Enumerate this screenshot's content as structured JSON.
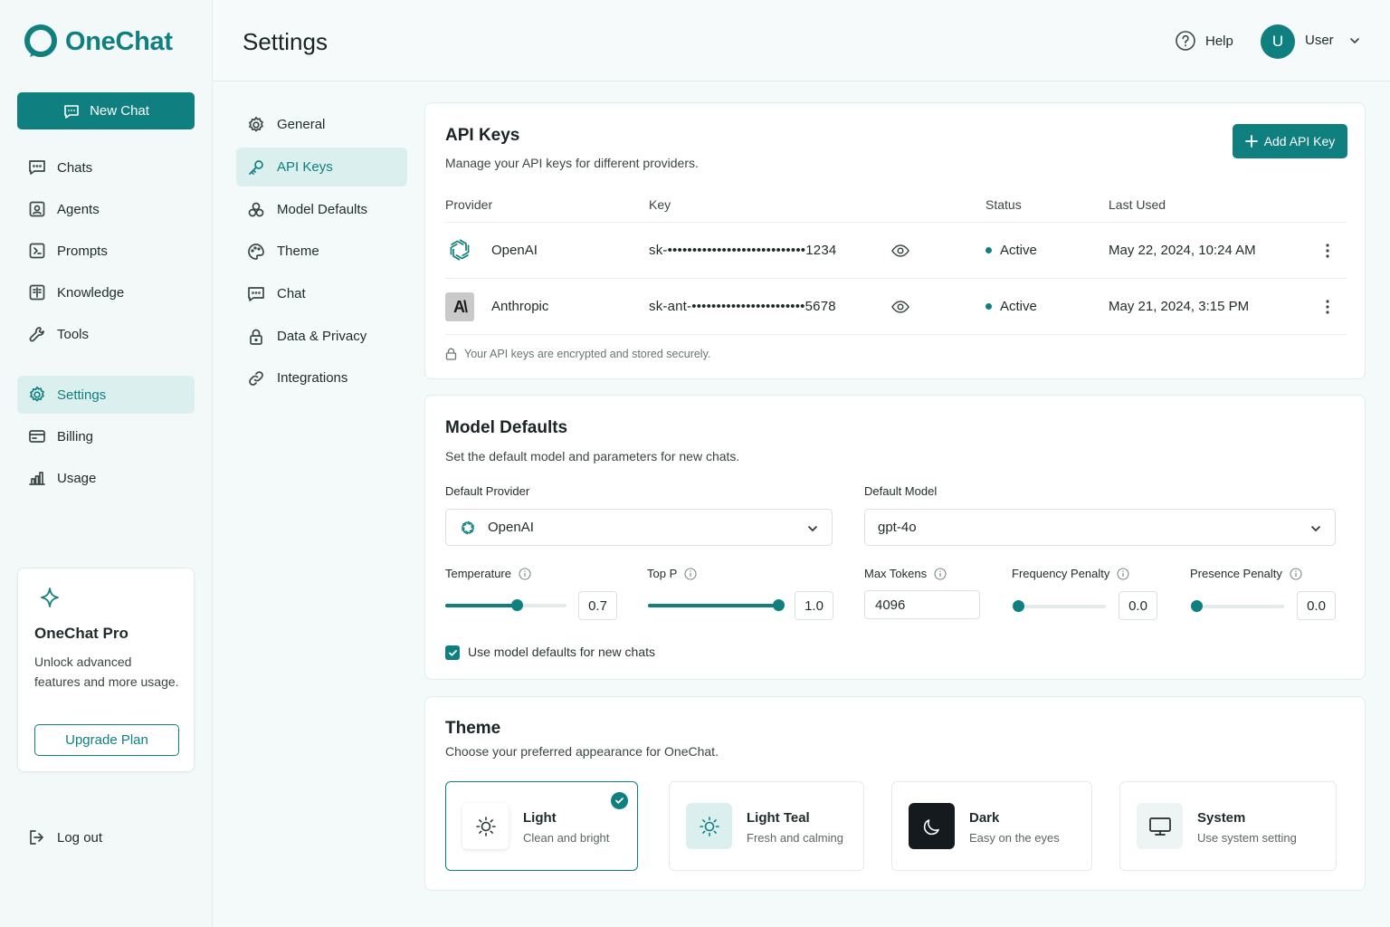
{
  "brand": {
    "name": "OneChat",
    "accent": "#0f7f7f"
  },
  "sidebar": {
    "new_chat": "New Chat",
    "items": [
      {
        "label": "Chats",
        "icon": "chat-bubble-icon"
      },
      {
        "label": "Agents",
        "icon": "agent-icon"
      },
      {
        "label": "Prompts",
        "icon": "prompt-icon"
      },
      {
        "label": "Knowledge",
        "icon": "knowledge-icon"
      },
      {
        "label": "Tools",
        "icon": "wrench-icon"
      },
      {
        "label": "Settings",
        "icon": "gear-icon",
        "active": true
      },
      {
        "label": "Billing",
        "icon": "billing-icon"
      },
      {
        "label": "Usage",
        "icon": "bar-chart-icon"
      }
    ],
    "pro_card": {
      "title": "OneChat Pro",
      "description": "Unlock advanced features and more usage.",
      "button": "Upgrade Plan"
    },
    "logout": "Log out"
  },
  "header": {
    "title": "Settings",
    "help": "Help",
    "avatar_initial": "U",
    "user": "User"
  },
  "settings_nav": [
    {
      "label": "General",
      "icon": "gear-icon"
    },
    {
      "label": "API Keys",
      "icon": "key-icon",
      "active": true
    },
    {
      "label": "Model Defaults",
      "icon": "cubes-icon"
    },
    {
      "label": "Theme",
      "icon": "palette-icon"
    },
    {
      "label": "Chat",
      "icon": "chat-bubble-icon"
    },
    {
      "label": "Data & Privacy",
      "icon": "lock-icon"
    },
    {
      "label": "Integrations",
      "icon": "link-icon"
    }
  ],
  "api_keys": {
    "title": "API Keys",
    "subtitle": "Manage your API keys for different providers.",
    "add_button": "Add API Key",
    "columns": [
      "Provider",
      "Key",
      "Status",
      "Last Used"
    ],
    "rows": [
      {
        "provider": "OpenAI",
        "key": "sk-••••••••••••••••••••••••••••1234",
        "status": "Active",
        "last_used": "May 22, 2024, 10:24 AM"
      },
      {
        "provider": "Anthropic",
        "key": "sk-ant-•••••••••••••••••••••••5678",
        "status": "Active",
        "last_used": "May 21, 2024, 3:15 PM"
      }
    ],
    "secure_note": "Your API keys are encrypted and stored securely."
  },
  "model_defaults": {
    "title": "Model Defaults",
    "subtitle": "Set the default model and parameters for new chats.",
    "provider_label": "Default Provider",
    "provider_value": "OpenAI",
    "model_label": "Default Model",
    "model_value": "gpt-4o",
    "temperature": {
      "label": "Temperature",
      "value": "0.7",
      "fraction": 0.59
    },
    "top_p": {
      "label": "Top P",
      "value": "1.0",
      "fraction": 1.0
    },
    "max_tokens": {
      "label": "Max Tokens",
      "value": "4096"
    },
    "frequency_penalty": {
      "label": "Frequency Penalty",
      "value": "0.0",
      "fraction": 0.0
    },
    "presence_penalty": {
      "label": "Presence Penalty",
      "value": "0.0",
      "fraction": 0.0
    },
    "use_defaults_label": "Use model defaults for new chats",
    "use_defaults_checked": true
  },
  "theme": {
    "title": "Theme",
    "subtitle": "Choose your preferred appearance for OneChat.",
    "options": [
      {
        "name": "Light",
        "desc": "Clean and bright",
        "selected": true
      },
      {
        "name": "Light Teal",
        "desc": "Fresh and calming"
      },
      {
        "name": "Dark",
        "desc": "Easy on the eyes"
      },
      {
        "name": "System",
        "desc": "Use system setting"
      }
    ]
  }
}
